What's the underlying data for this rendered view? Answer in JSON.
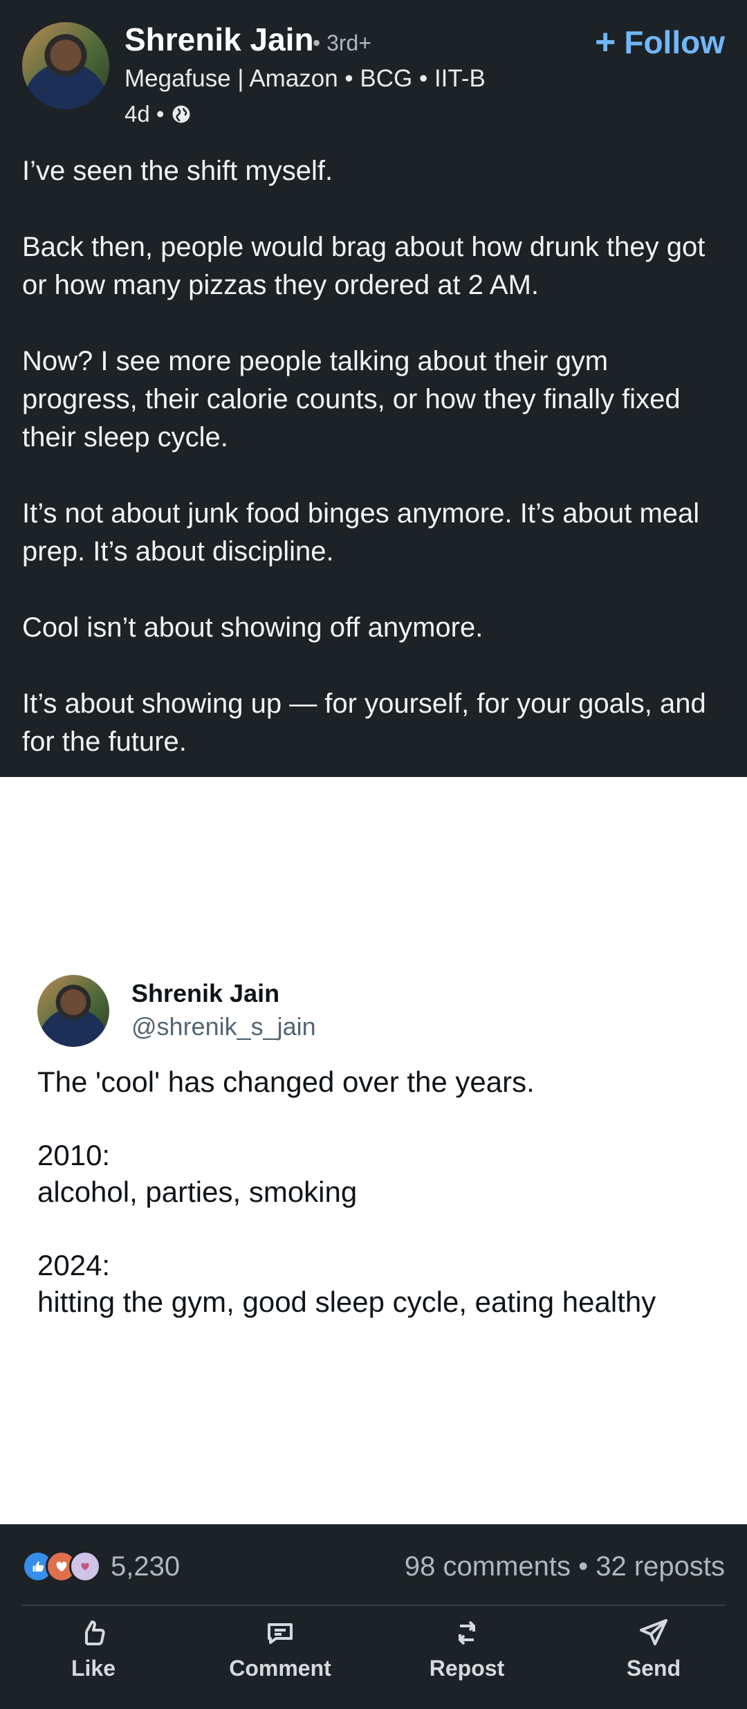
{
  "post": {
    "author": "Shrenik Jain",
    "degree": "• 3rd+",
    "headline": "Megafuse | Amazon • BCG • IIT-B",
    "time": "4d •",
    "follow_label": "Follow",
    "follow_plus": "+",
    "paragraphs": [
      "I’ve seen the shift myself.",
      "Back then, people would brag about how drunk they got or how many pizzas they ordered at 2 AM.",
      "Now? I see more people talking about their gym progress, their calorie counts, or how they finally fixed their sleep cycle.",
      "It’s not about junk food binges anymore. It’s about meal prep. It’s about discipline.",
      "Cool isn’t about showing off anymore.",
      "It’s about showing up — for yourself, for your goals, and for the future."
    ]
  },
  "tweet": {
    "name": "Shrenik Jain",
    "handle": "@shrenik_s_jain",
    "line1": "The 'cool' has changed over the years.",
    "year1": "2010:",
    "items1": "alcohol, parties, smoking",
    "year2": "2024:",
    "items2": "hitting the gym, good sleep cycle, eating healthy"
  },
  "stats": {
    "reaction_count": "5,230",
    "comments_reposts": "98 comments • 32 reposts"
  },
  "actions": {
    "like": "Like",
    "comment": "Comment",
    "repost": "Repost",
    "send": "Send"
  },
  "icons": {
    "globe": "globe-icon",
    "like": "thumbs-up-icon",
    "comment": "speech-bubble-icon",
    "repost": "repost-arrows-icon",
    "send": "paper-plane-icon"
  },
  "colors": {
    "background": "#1d2226",
    "follow_accent": "#71b7fb",
    "card_background": "#ffffff",
    "muted_text": "#b0b7bd"
  }
}
